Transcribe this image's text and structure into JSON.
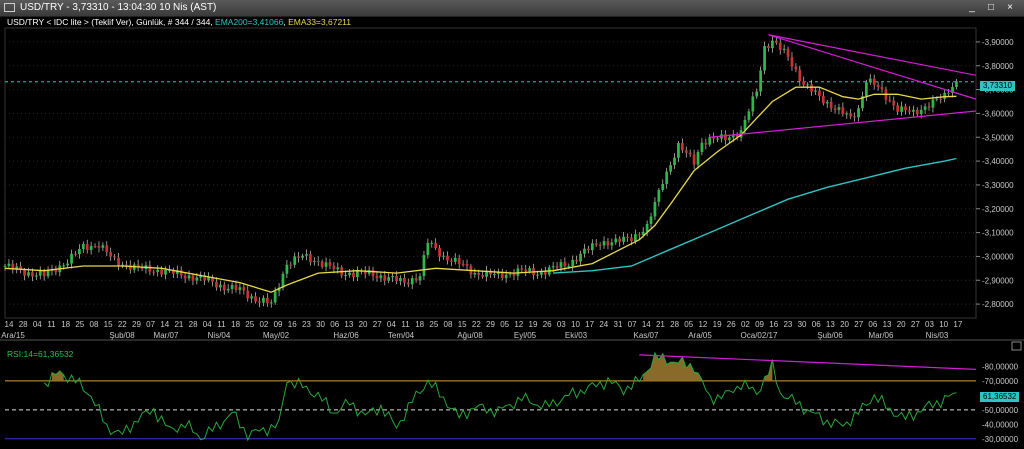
{
  "window": {
    "title": "USD/TRY - 3,73310 - 13:04:30  10 Nis (AST)",
    "min_label": "_",
    "max_label": "□",
    "close_label": "×"
  },
  "legend": {
    "main_text": "USD/TRY < IDC lite > (Teklif Ver), Günlük, # 344 / 344, ",
    "ema200_text": "EMA200=3,41066",
    "sep": ", ",
    "ema33_text": "EMA33=3,67211"
  },
  "rsi_legend": "RSI:14=61,36532",
  "price_tag": "3,73310",
  "rsi_tag": "61,36532",
  "colors": {
    "up": "#2fb84a",
    "down": "#c83232",
    "ema33": "#e8d84a",
    "ema200": "#2ec4c4",
    "trendline": "#d21ed2",
    "rsi": "#27a83a",
    "rsi_fill": "#8a6a28",
    "overbought": "#d9a037",
    "oversold": "#3a3ad0",
    "grid": "#2a2a2a"
  },
  "chart_data": [
    {
      "type": "candlestick",
      "title": "USD/TRY",
      "y_ticks": [
        "3,90000",
        "3,80000",
        "3,70000",
        "3,60000",
        "3,50000",
        "3,40000",
        "3,30000",
        "3,20000",
        "3,10000",
        "3,00000",
        "2,90000",
        "2,80000"
      ],
      "ylim": [
        2.75,
        3.95
      ],
      "last_price": 3.7331,
      "x_day_ticks": [
        "14",
        "28",
        "04",
        "11",
        "18",
        "25",
        "08",
        "15",
        "22",
        "29",
        "07",
        "14",
        "21",
        "28",
        "04",
        "11",
        "18",
        "25",
        "02",
        "09",
        "16",
        "23",
        "30",
        "06",
        "13",
        "20",
        "27",
        "04",
        "11",
        "18",
        "25",
        "08",
        "15",
        "22",
        "29",
        "05",
        "12",
        "19",
        "26",
        "03",
        "10",
        "17",
        "24",
        "31",
        "07",
        "14",
        "21",
        "28",
        "05",
        "12",
        "19",
        "26",
        "02",
        "09",
        "16",
        "23",
        "30",
        "06",
        "13",
        "20",
        "27",
        "06",
        "13",
        "20",
        "27",
        "03",
        "10",
        "17"
      ],
      "x_month_ticks": [
        "Ara/15",
        "Şub/08",
        "Mar/07",
        "Nis/04",
        "May/02",
        "Haz/06",
        "Tem/04",
        "Ağu/08",
        "Eyl/05",
        "Eki/03",
        "Kas/07",
        "Ara/05",
        "Oca/02/17",
        "Şub/06",
        "Mar/06",
        "Nis/03"
      ],
      "close_path": [
        [
          0,
          2.96
        ],
        [
          6,
          2.93
        ],
        [
          10,
          2.92
        ],
        [
          16,
          2.98
        ],
        [
          20,
          3.04
        ],
        [
          24,
          3.05
        ],
        [
          28,
          2.98
        ],
        [
          34,
          2.95
        ],
        [
          40,
          2.94
        ],
        [
          46,
          2.92
        ],
        [
          52,
          2.9
        ],
        [
          56,
          2.87
        ],
        [
          60,
          2.86
        ],
        [
          64,
          2.82
        ],
        [
          68,
          2.8
        ],
        [
          72,
          2.97
        ],
        [
          76,
          3.0
        ],
        [
          80,
          2.98
        ],
        [
          86,
          2.93
        ],
        [
          92,
          2.93
        ],
        [
          98,
          2.91
        ],
        [
          102,
          2.89
        ],
        [
          106,
          2.92
        ],
        [
          108,
          3.06
        ],
        [
          112,
          3.0
        ],
        [
          116,
          2.97
        ],
        [
          120,
          2.93
        ],
        [
          126,
          2.92
        ],
        [
          132,
          2.94
        ],
        [
          136,
          2.93
        ],
        [
          140,
          2.95
        ],
        [
          144,
          2.97
        ],
        [
          148,
          3.02
        ],
        [
          152,
          3.06
        ],
        [
          156,
          3.06
        ],
        [
          160,
          3.08
        ],
        [
          164,
          3.12
        ],
        [
          166,
          3.22
        ],
        [
          168,
          3.32
        ],
        [
          172,
          3.46
        ],
        [
          176,
          3.4
        ],
        [
          178,
          3.48
        ],
        [
          184,
          3.5
        ],
        [
          188,
          3.52
        ],
        [
          192,
          3.7
        ],
        [
          194,
          3.88
        ],
        [
          196,
          3.9
        ],
        [
          200,
          3.84
        ],
        [
          204,
          3.72
        ],
        [
          208,
          3.67
        ],
        [
          212,
          3.62
        ],
        [
          216,
          3.58
        ],
        [
          218,
          3.62
        ],
        [
          220,
          3.74
        ],
        [
          222,
          3.72
        ],
        [
          224,
          3.69
        ],
        [
          228,
          3.62
        ],
        [
          232,
          3.6
        ],
        [
          236,
          3.64
        ],
        [
          240,
          3.67
        ],
        [
          242,
          3.72
        ],
        [
          243,
          3.733
        ]
      ],
      "ema33_path": [
        [
          0,
          2.95
        ],
        [
          10,
          2.94
        ],
        [
          20,
          2.96
        ],
        [
          30,
          2.96
        ],
        [
          40,
          2.95
        ],
        [
          50,
          2.92
        ],
        [
          60,
          2.89
        ],
        [
          68,
          2.85
        ],
        [
          72,
          2.88
        ],
        [
          80,
          2.93
        ],
        [
          90,
          2.94
        ],
        [
          100,
          2.93
        ],
        [
          110,
          2.95
        ],
        [
          120,
          2.94
        ],
        [
          130,
          2.93
        ],
        [
          140,
          2.94
        ],
        [
          150,
          2.97
        ],
        [
          156,
          3.02
        ],
        [
          162,
          3.07
        ],
        [
          166,
          3.13
        ],
        [
          170,
          3.22
        ],
        [
          176,
          3.36
        ],
        [
          182,
          3.44
        ],
        [
          188,
          3.51
        ],
        [
          192,
          3.58
        ],
        [
          196,
          3.65
        ],
        [
          202,
          3.71
        ],
        [
          208,
          3.71
        ],
        [
          214,
          3.67
        ],
        [
          218,
          3.66
        ],
        [
          222,
          3.68
        ],
        [
          228,
          3.68
        ],
        [
          234,
          3.66
        ],
        [
          240,
          3.67
        ],
        [
          243,
          3.672
        ]
      ],
      "ema200_path": [
        [
          140,
          2.93
        ],
        [
          150,
          2.94
        ],
        [
          160,
          2.96
        ],
        [
          170,
          3.03
        ],
        [
          180,
          3.1
        ],
        [
          190,
          3.17
        ],
        [
          200,
          3.24
        ],
        [
          210,
          3.29
        ],
        [
          220,
          3.33
        ],
        [
          230,
          3.37
        ],
        [
          240,
          3.4
        ],
        [
          243,
          3.411
        ]
      ],
      "trendlines": [
        {
          "name": "upper",
          "from": [
            195,
            3.93
          ],
          "to": [
            248,
            3.76
          ]
        },
        {
          "name": "upper-inner",
          "from": [
            195,
            3.93
          ],
          "to": [
            248,
            3.66
          ]
        },
        {
          "name": "lower",
          "from": [
            180,
            3.5
          ],
          "to": [
            248,
            3.61
          ]
        }
      ]
    },
    {
      "type": "line",
      "title": "RSI",
      "series_name": "RSI:14",
      "y_ticks": [
        "80,00000",
        "70,00000",
        "50,00000",
        "40,00000",
        "30,00000"
      ],
      "ylim": [
        25,
        90
      ],
      "overbought": 70,
      "midline": 50,
      "oversold": 30,
      "last_value": 61.36532,
      "path": [
        [
          10,
          68
        ],
        [
          14,
          76
        ],
        [
          18,
          70
        ],
        [
          22,
          60
        ],
        [
          26,
          38
        ],
        [
          30,
          33
        ],
        [
          34,
          44
        ],
        [
          38,
          50
        ],
        [
          42,
          36
        ],
        [
          46,
          40
        ],
        [
          50,
          31
        ],
        [
          54,
          38
        ],
        [
          58,
          48
        ],
        [
          62,
          33
        ],
        [
          66,
          36
        ],
        [
          70,
          40
        ],
        [
          72,
          71
        ],
        [
          76,
          66
        ],
        [
          80,
          60
        ],
        [
          84,
          48
        ],
        [
          88,
          55
        ],
        [
          92,
          46
        ],
        [
          96,
          52
        ],
        [
          100,
          38
        ],
        [
          104,
          56
        ],
        [
          108,
          70
        ],
        [
          112,
          58
        ],
        [
          116,
          45
        ],
        [
          120,
          52
        ],
        [
          126,
          49
        ],
        [
          132,
          58
        ],
        [
          138,
          52
        ],
        [
          144,
          60
        ],
        [
          150,
          66
        ],
        [
          154,
          70
        ],
        [
          158,
          64
        ],
        [
          162,
          70
        ],
        [
          166,
          86
        ],
        [
          170,
          84
        ],
        [
          176,
          80
        ],
        [
          180,
          58
        ],
        [
          184,
          60
        ],
        [
          188,
          68
        ],
        [
          192,
          62
        ],
        [
          196,
          80
        ],
        [
          198,
          62
        ],
        [
          202,
          55
        ],
        [
          206,
          48
        ],
        [
          210,
          42
        ],
        [
          214,
          39
        ],
        [
          218,
          48
        ],
        [
          222,
          60
        ],
        [
          226,
          50
        ],
        [
          230,
          44
        ],
        [
          234,
          50
        ],
        [
          238,
          55
        ],
        [
          243,
          61
        ]
      ],
      "trendline": {
        "from": [
          162,
          88
        ],
        "to": [
          248,
          78
        ]
      }
    }
  ]
}
